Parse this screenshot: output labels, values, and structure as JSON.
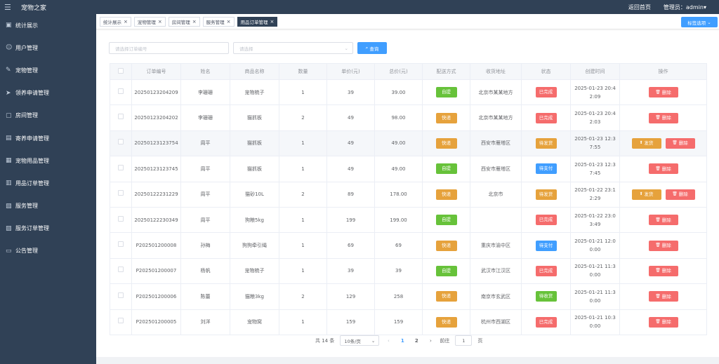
{
  "header": {
    "app_title": "宠物之家",
    "home_link": "返回首页",
    "admin_label": "管理员：admin"
  },
  "sidebar": {
    "items": [
      {
        "label": "统计展示",
        "icon": "chart-icon"
      },
      {
        "label": "用户管理",
        "icon": "user-icon"
      },
      {
        "label": "宠物管理",
        "icon": "pet-icon"
      },
      {
        "label": "领养申请管理",
        "icon": "send-icon"
      },
      {
        "label": "房间管理",
        "icon": "room-icon"
      },
      {
        "label": "寄养申请管理",
        "icon": "foster-icon"
      },
      {
        "label": "宠物用品管理",
        "icon": "goods-icon"
      },
      {
        "label": "用品订单管理",
        "icon": "order-icon"
      },
      {
        "label": "服务管理",
        "icon": "service-icon"
      },
      {
        "label": "服务订单管理",
        "icon": "service-order-icon"
      },
      {
        "label": "公告管理",
        "icon": "notice-icon"
      }
    ]
  },
  "tags": {
    "items": [
      "统计展示",
      "宠物管理",
      "房间管理",
      "服务管理",
      "用品订单管理"
    ],
    "active_index": 4,
    "options_label": "标签选项"
  },
  "filters": {
    "order_placeholder": "请选择订单编号",
    "status_placeholder": "请选择",
    "search_label": "查询"
  },
  "table": {
    "headers": [
      "订单编号",
      "姓名",
      "商品名称",
      "数量",
      "单价(元)",
      "总价(元)",
      "配送方式",
      "收货地址",
      "状态",
      "创建时间",
      "操作"
    ],
    "rows": [
      {
        "order": "20250123204209",
        "name": "李珊珊",
        "product": "宠物梳子",
        "qty": "1",
        "price": "39",
        "total": "39.00",
        "delivery": "自提",
        "address": "北京市某某地方",
        "status": "已完成",
        "created": "2025-01-23 20:42:09",
        "actions": [
          "删除"
        ]
      },
      {
        "order": "20250123204202",
        "name": "李珊珊",
        "product": "猫抓板",
        "qty": "2",
        "price": "49",
        "total": "98.00",
        "delivery": "快递",
        "address": "北京市某某地方",
        "status": "已完成",
        "created": "2025-01-23 20:42:03",
        "actions": [
          "删除"
        ]
      },
      {
        "order": "20250123123754",
        "name": "周平",
        "product": "猫抓板",
        "qty": "1",
        "price": "49",
        "total": "49.00",
        "delivery": "快递",
        "address": "西安市雁塔区",
        "status": "待发货",
        "created": "2025-01-23 12:37:55",
        "actions": [
          "发货",
          "删除"
        ]
      },
      {
        "order": "20250123123745",
        "name": "周平",
        "product": "猫抓板",
        "qty": "1",
        "price": "49",
        "total": "49.00",
        "delivery": "自提",
        "address": "西安市雁塔区",
        "status": "待支付",
        "created": "2025-01-23 12:37:45",
        "actions": [
          "删除"
        ]
      },
      {
        "order": "20250122231229",
        "name": "周平",
        "product": "猫砂10L",
        "qty": "2",
        "price": "89",
        "total": "178.00",
        "delivery": "快递",
        "address": "北京市",
        "status": "待发货",
        "created": "2025-01-22 23:12:29",
        "actions": [
          "发货",
          "删除"
        ]
      },
      {
        "order": "20250122230349",
        "name": "周平",
        "product": "狗粮5kg",
        "qty": "1",
        "price": "199",
        "total": "199.00",
        "delivery": "自提",
        "address": "",
        "status": "已完成",
        "created": "2025-01-22 23:03:49",
        "actions": [
          "删除"
        ]
      },
      {
        "order": "P202501200008",
        "name": "孙梅",
        "product": "狗狗牵引绳",
        "qty": "1",
        "price": "69",
        "total": "69",
        "delivery": "快递",
        "address": "重庆市渝中区",
        "status": "待支付",
        "created": "2025-01-21 12:00:00",
        "actions": [
          "删除"
        ]
      },
      {
        "order": "P202501200007",
        "name": "杨帆",
        "product": "宠物梳子",
        "qty": "1",
        "price": "39",
        "total": "39",
        "delivery": "自提",
        "address": "武汉市江汉区",
        "status": "已完成",
        "created": "2025-01-21 11:30:00",
        "actions": [
          "删除"
        ]
      },
      {
        "order": "P202501200006",
        "name": "陈蕾",
        "product": "猫粮3kg",
        "qty": "2",
        "price": "129",
        "total": "258",
        "delivery": "快递",
        "address": "南京市玄武区",
        "status": "待收货",
        "created": "2025-01-21 11:30:00",
        "actions": [
          "删除"
        ]
      },
      {
        "order": "P202501200005",
        "name": "刘洋",
        "product": "宠物窝",
        "qty": "1",
        "price": "159",
        "total": "159",
        "delivery": "快递",
        "address": "杭州市西湖区",
        "status": "已完成",
        "created": "2025-01-21 10:30:00",
        "actions": [
          "删除"
        ]
      }
    ]
  },
  "pagination": {
    "total_label": "共 14 条",
    "page_size": "10条/页",
    "pages": [
      "1",
      "2"
    ],
    "active_page": "1",
    "goto_label": "前往",
    "goto_value": "1",
    "page_suffix": "页"
  },
  "colors": {
    "sidebar_bg": "#304156",
    "primary": "#409eff",
    "success": "#67c23a",
    "warning": "#e6a23c",
    "danger": "#f56c6c"
  }
}
